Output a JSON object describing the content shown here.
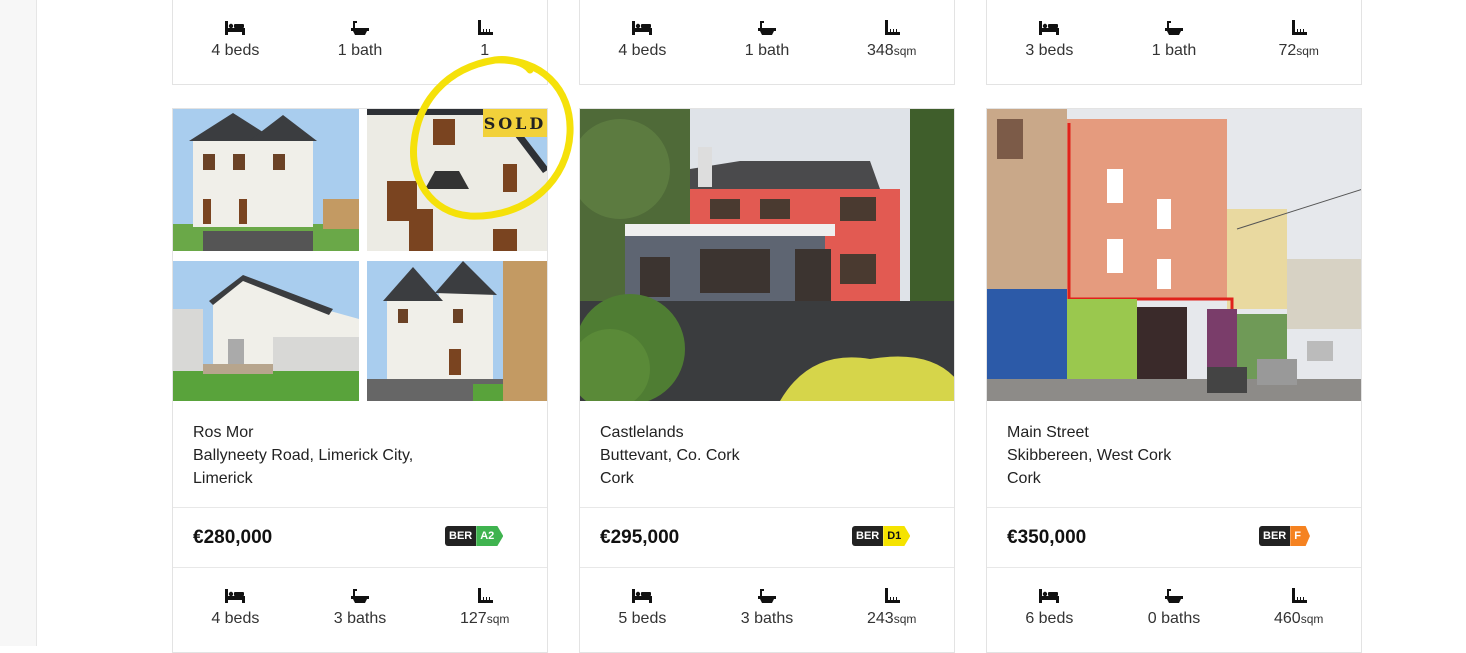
{
  "top_row": [
    {
      "beds": "4 beds",
      "baths": "1 bath",
      "area": "1",
      "area_unit": ""
    },
    {
      "beds": "4 beds",
      "baths": "1 bath",
      "area": "348",
      "area_unit": "sqm"
    },
    {
      "beds": "3 beds",
      "baths": "1 bath",
      "area": "72",
      "area_unit": "sqm"
    }
  ],
  "listings": [
    {
      "sold_label": "SOLD",
      "address": [
        "Ros Mor",
        "Ballyneety Road, Limerick City,",
        "Limerick"
      ],
      "price": "€280,000",
      "ber": {
        "prefix": "BER",
        "rating": "A2",
        "color": "#3fb34f",
        "text_color": "#ffffff"
      },
      "beds": "4 beds",
      "baths": "3 baths",
      "area": "127",
      "area_unit": "sqm"
    },
    {
      "address": [
        "Castlelands",
        "Buttevant, Co. Cork",
        "Cork"
      ],
      "price": "€295,000",
      "ber": {
        "prefix": "BER",
        "rating": "D1",
        "color": "#f5e300",
        "text_color": "#111111"
      },
      "beds": "5 beds",
      "baths": "3 baths",
      "area": "243",
      "area_unit": "sqm"
    },
    {
      "address": [
        "Main Street",
        "Skibbereen, West Cork",
        "Cork"
      ],
      "price": "€350,000",
      "ber": {
        "prefix": "BER",
        "rating": "F",
        "color": "#f58220",
        "text_color": "#ffffff"
      },
      "beds": "6 beds",
      "baths": "0 baths",
      "area": "460",
      "area_unit": "sqm"
    }
  ],
  "icons": {
    "beds": "bed-icon",
    "baths": "bath-icon",
    "area": "area-ruler-icon"
  },
  "annotation": {
    "color": "#f5e10a"
  }
}
